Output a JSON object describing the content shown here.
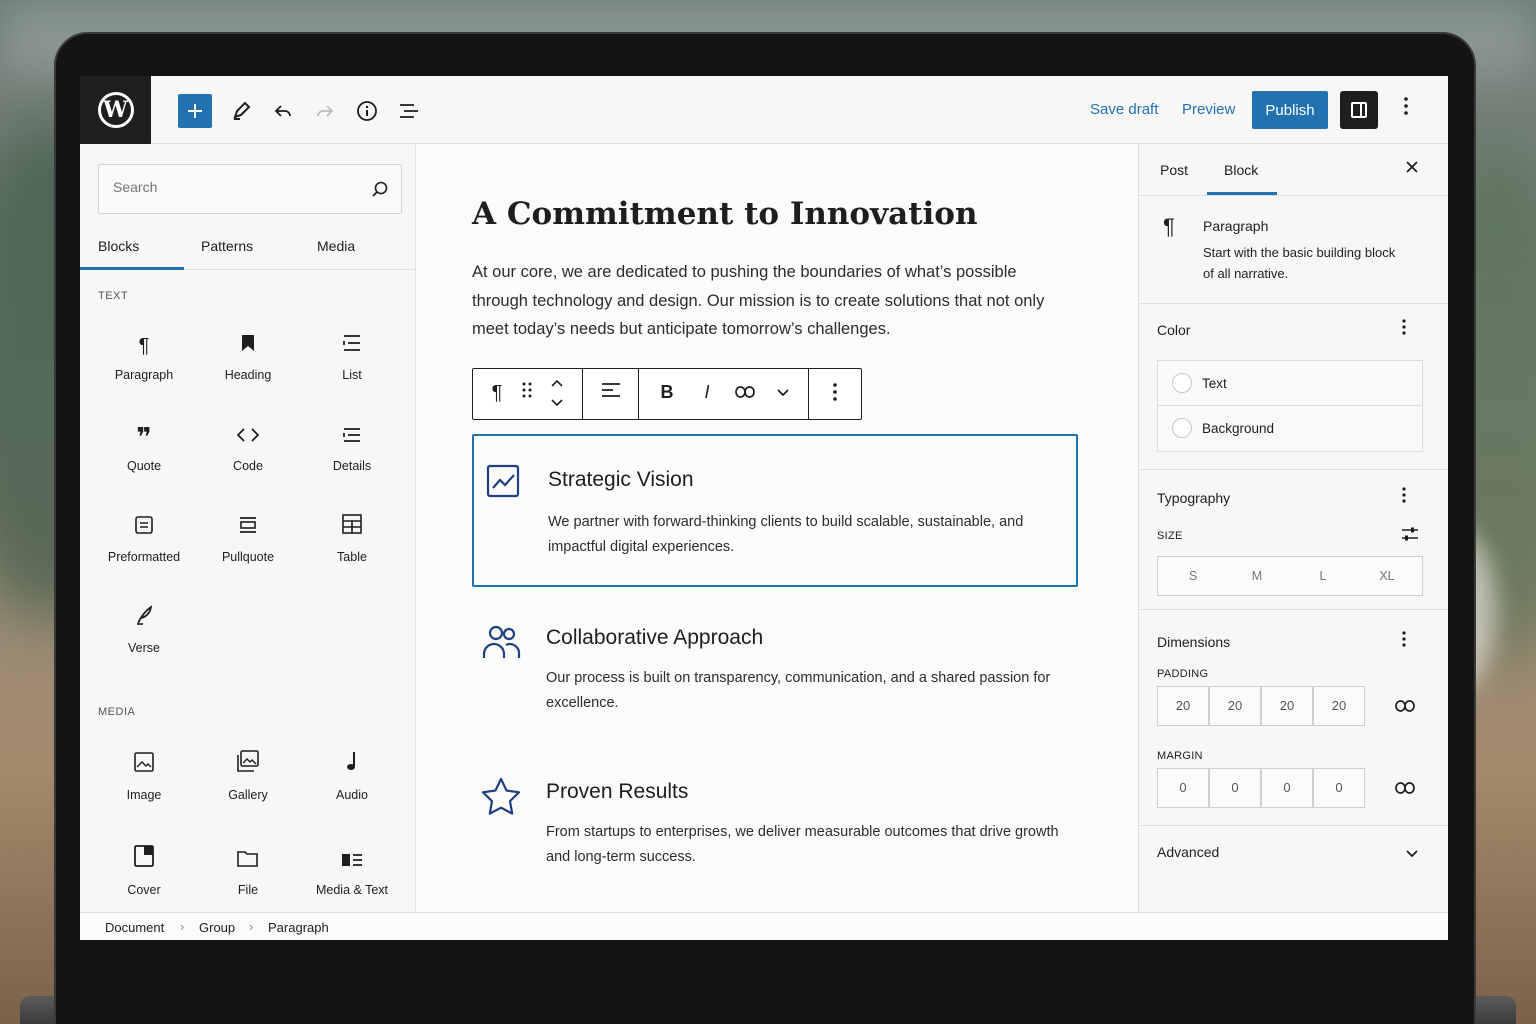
{
  "topbar": {
    "save_draft": "Save draft",
    "preview": "Preview",
    "publish": "Publish"
  },
  "inserter": {
    "search_placeholder": "Search",
    "tabs": [
      "Blocks",
      "Patterns",
      "Media"
    ],
    "text_section": "TEXT",
    "text_blocks": [
      {
        "label": "Paragraph",
        "icon": "paragraph-icon"
      },
      {
        "label": "Heading",
        "icon": "heading-icon"
      },
      {
        "label": "List",
        "icon": "list-icon"
      },
      {
        "label": "Quote",
        "icon": "quote-icon"
      },
      {
        "label": "Code",
        "icon": "code-icon"
      },
      {
        "label": "Details",
        "icon": "details-icon"
      },
      {
        "label": "Preformatted",
        "icon": "preformatted-icon"
      },
      {
        "label": "Pullquote",
        "icon": "pullquote-icon"
      },
      {
        "label": "Table",
        "icon": "table-icon"
      },
      {
        "label": "Verse",
        "icon": "verse-icon"
      }
    ],
    "media_section": "MEDIA",
    "media_blocks": [
      {
        "label": "Image",
        "icon": "image-icon"
      },
      {
        "label": "Gallery",
        "icon": "gallery-icon"
      },
      {
        "label": "Audio",
        "icon": "audio-icon"
      },
      {
        "label": "Cover",
        "icon": "cover-icon"
      },
      {
        "label": "File",
        "icon": "file-icon"
      },
      {
        "label": "Media & Text",
        "icon": "media-text-icon"
      }
    ]
  },
  "editor": {
    "title": "A Commitment to Innovation",
    "intro": "At our core, we are dedicated to pushing the boundaries of what’s possible through technology and design. Our mission is to create solutions that not only meet today’s needs but anticipate tomorrow’s challenges.",
    "features": [
      {
        "title": "Strategic Vision",
        "desc": "We partner with forward-thinking clients to build scalable, sustainable, and impactful digital experiences.",
        "icon": "chart-icon"
      },
      {
        "title": "Collaborative Approach",
        "desc": "Our process is built on transparency, communication, and a shared passion for excellence.",
        "icon": "people-icon"
      },
      {
        "title": "Proven Results",
        "desc": "From startups to enterprises, we deliver measurable outcomes that drive growth and long-term success.",
        "icon": "star-icon"
      }
    ]
  },
  "sidebar": {
    "tabs": [
      "Post",
      "Block"
    ],
    "active_tab": "Block",
    "block_name": "Paragraph",
    "block_desc": "Start with the basic building block of all narrative.",
    "color_title": "Color",
    "color_options": [
      "Text",
      "Background"
    ],
    "typography_title": "Typography",
    "size_label": "SIZE",
    "size_options": [
      "S",
      "M",
      "L",
      "XL"
    ],
    "dimensions_title": "Dimensions",
    "padding_label": "PADDING",
    "padding_values": [
      "20",
      "20",
      "20",
      "20"
    ],
    "margin_label": "MARGIN",
    "margin_values": [
      "0",
      "0",
      "0",
      "0"
    ],
    "advanced_title": "Advanced"
  },
  "breadcrumb": [
    "Document",
    "Group",
    "Paragraph"
  ],
  "colors": {
    "accent": "#2271b1",
    "dark": "#1e1e1e",
    "icon_navy": "#1f3f80"
  }
}
